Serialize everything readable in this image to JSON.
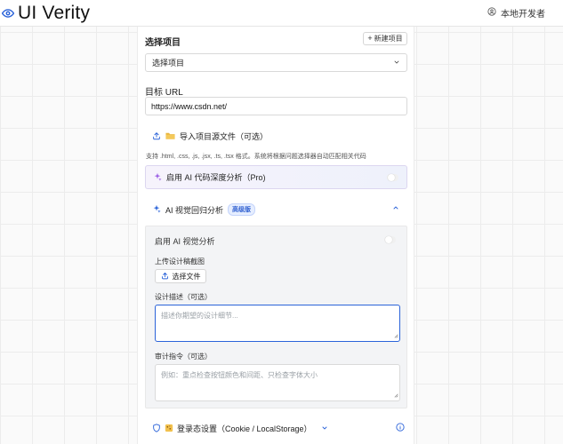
{
  "header": {
    "app_title": "UI Verity",
    "user_label": "本地开发者"
  },
  "project": {
    "label": "选择项目",
    "new_button": "新建项目",
    "select_value": "选择项目"
  },
  "target_url": {
    "label": "目标 URL",
    "value": "https://www.csdn.net/"
  },
  "import": {
    "label": "导入项目源文件（可选）",
    "hint": "支持 .html, .css, .js, .jsx, .ts, .tsx 格式。系统将根据问题选择器自动匹配相关代码"
  },
  "ai_code_analysis": {
    "label": "启用 AI 代码深度分析（Pro)",
    "enabled": false
  },
  "visual_regression": {
    "title": "AI 视觉回归分析",
    "badge": "高级版",
    "enable_label": "启用 AI 视觉分析",
    "enabled": false,
    "upload_label": "上传设计稿截图",
    "choose_file_button": "选择文件",
    "design_desc_label": "设计描述（可选）",
    "design_desc_placeholder": "描述你期望的设计细节...",
    "audit_label": "审计指令（可选）",
    "audit_placeholder": "例如：重点检查按钮颜色和间距、只检查字体大小"
  },
  "login_state": {
    "label": "登录态设置（Cookie / LocalStorage）"
  },
  "colors": {
    "accent": "#2b63d9",
    "badge_bg": "#e6eeff",
    "pro_card_bg": "#f6f3fc"
  }
}
